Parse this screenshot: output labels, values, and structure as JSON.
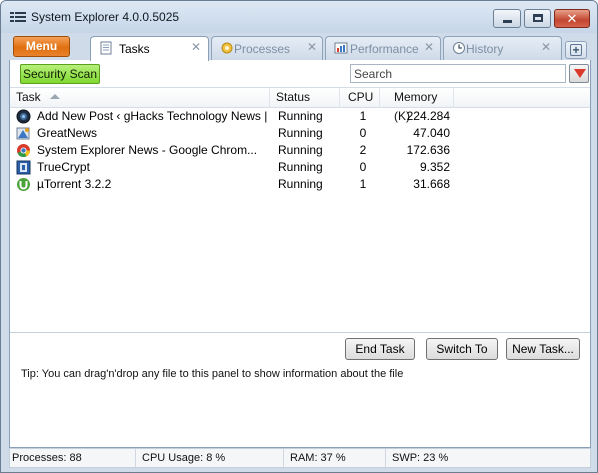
{
  "window": {
    "title": "System Explorer 4.0.0.5025",
    "close_glyph": "✕"
  },
  "menu": {
    "label": "Menu"
  },
  "tabs": [
    {
      "label": "Tasks",
      "icon": "document-icon",
      "active": true
    },
    {
      "label": "Processes",
      "icon": "gears-icon",
      "active": false
    },
    {
      "label": "Performance",
      "icon": "performance-chart-icon",
      "active": false
    },
    {
      "label": "History",
      "icon": "clock-icon",
      "active": false
    }
  ],
  "tab_close_glyph": "✕",
  "toolbar": {
    "security_scan_label": "Security Scan",
    "search_placeholder": "Search"
  },
  "list": {
    "columns": {
      "task": "Task",
      "status": "Status",
      "cpu": "CPU",
      "memory": "Memory (K)"
    },
    "sort_column": "task",
    "sort_direction": "ascending",
    "rows": [
      {
        "icon": "globe-icon",
        "task": "Add New Post ‹ gHacks Technology News | L...",
        "status": "Running",
        "cpu": "1",
        "memory": "224.284"
      },
      {
        "icon": "greatnews-icon",
        "task": "GreatNews",
        "status": "Running",
        "cpu": "0",
        "memory": "47.040"
      },
      {
        "icon": "chrome-icon",
        "task": "System Explorer News - Google Chrom...",
        "status": "Running",
        "cpu": "2",
        "memory": "172.636"
      },
      {
        "icon": "truecrypt-icon",
        "task": "TrueCrypt",
        "status": "Running",
        "cpu": "0",
        "memory": "9.352"
      },
      {
        "icon": "utorrent-icon",
        "task": "µTorrent 3.2.2",
        "status": "Running",
        "cpu": "1",
        "memory": "31.668"
      }
    ]
  },
  "actions": {
    "end_task": "End Task",
    "switch_to": "Switch To",
    "new_task": "New Task..."
  },
  "tip": "Tip: You can drag'n'drop any file to this panel to show information about the file",
  "statusbar": {
    "processes": "Processes: 88",
    "cpu_usage": "CPU Usage: 8 %",
    "ram": "RAM: 37 %",
    "swp": "SWP: 23 %"
  },
  "colors": {
    "menu_button": "#e0700f",
    "security_scan": "#80d832",
    "close_button": "#c24631",
    "window_frame": "#cfdbe9"
  }
}
